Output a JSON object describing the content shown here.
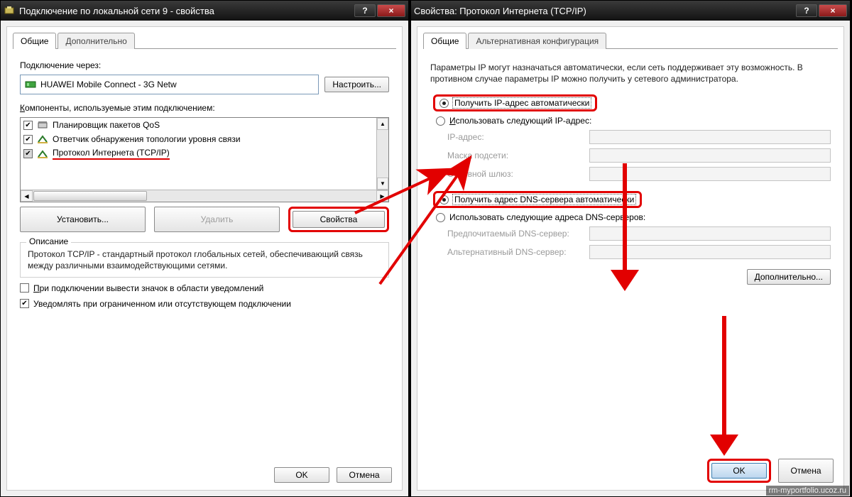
{
  "watermark": "rm-myportfolio.ucoz.ru",
  "win1": {
    "title": "Подключение по локальной сети 9 - свойства",
    "tabs": {
      "general": "Общие",
      "advanced": "Дополнительно"
    },
    "connect_using": "Подключение через:",
    "adapter": "HUAWEI Mobile Connect - 3G Netw",
    "configure": "Настроить...",
    "components_label": "Компоненты, используемые этим подключением:",
    "components": [
      {
        "checked": true,
        "label": "Планировщик пакетов QoS"
      },
      {
        "checked": true,
        "label": "Ответчик обнаружения топологии уровня связи"
      },
      {
        "checked": "gray",
        "label": "Протокол Интернета (TCP/IP)"
      }
    ],
    "install": "Установить...",
    "remove": "Удалить",
    "properties": "Свойства",
    "desc_title": "Описание",
    "desc_text": "Протокол TCP/IP - стандартный протокол глобальных сетей, обеспечивающий связь между различными взаимодействующими сетями.",
    "show_icon": "При подключении вывести значок в области уведомлений",
    "notify_limited": "Уведомлять при ограниченном или отсутствующем подключении",
    "ok": "OK",
    "cancel": "Отмена",
    "comp_prefix_K": "К"
  },
  "win2": {
    "title": "Свойства: Протокол Интернета (TCP/IP)",
    "tabs": {
      "general": "Общие",
      "alt": "Альтернативная конфигурация"
    },
    "info": "Параметры IP могут назначаться автоматически, если сеть поддерживает эту возможность. В противном случае параметры IP можно получить у сетевого администратора.",
    "ip_auto": "Получить IP-адрес автоматически",
    "ip_manual": "Использовать следующий IP-адрес:",
    "ip_addr": "IP-адрес:",
    "mask": "Маска подсети:",
    "gw": "Основной шлюз:",
    "dns_auto": "Получить адрес DNS-сервера автоматически",
    "dns_manual": "Использовать следующие адреса DNS-серверов:",
    "dns_pref": "Предпочитаемый DNS-сервер:",
    "dns_alt": "Альтернативный DNS-сервер:",
    "advanced": "Дополнительно...",
    "ok": "OK",
    "cancel": "Отмена",
    "letters": {
      "P_ipauto": "П",
      "I_ipmanual": "И",
      "I_ip": "I",
      "M_mask": "М",
      "O_gw": "О",
      "P_dnsauto": "П",
      "I_dnsmanual": "с",
      "P_pref": "р",
      "A_alt": "А",
      "D_adv": "Д"
    }
  }
}
